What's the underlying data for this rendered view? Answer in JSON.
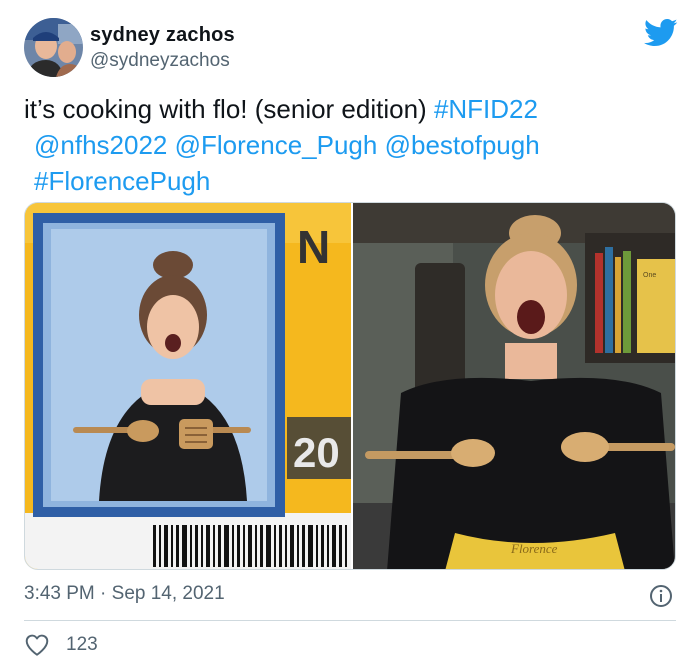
{
  "author": {
    "display_name": "sydney zachos",
    "handle": "@sydneyzachos"
  },
  "tweet": {
    "line1_text": "it’s cooking with flo! (senior edition) ",
    "line1_tag": "#NFID22",
    "line2_mention1": "@nfhs2022",
    "line2_mention2": "@Florence_Pugh",
    "line2_mention3": "@bestofpugh",
    "line3_tag": "#FlorencePugh",
    "timestamp": "3:43 PM · Sep 14, 2021",
    "like_count": "123"
  },
  "media": {
    "id_card_letter": "N",
    "id_card_year": "20",
    "apron_text": "Florence",
    "book_text": "One Pot, Pan Planet"
  },
  "colors": {
    "link": "#1d9bf0",
    "text": "#0f1419",
    "secondary": "#536471",
    "id_card_yellow": "#f5b81e"
  },
  "icons": {
    "brand": "twitter-bird-icon",
    "info": "info-icon",
    "like": "heart-icon"
  }
}
